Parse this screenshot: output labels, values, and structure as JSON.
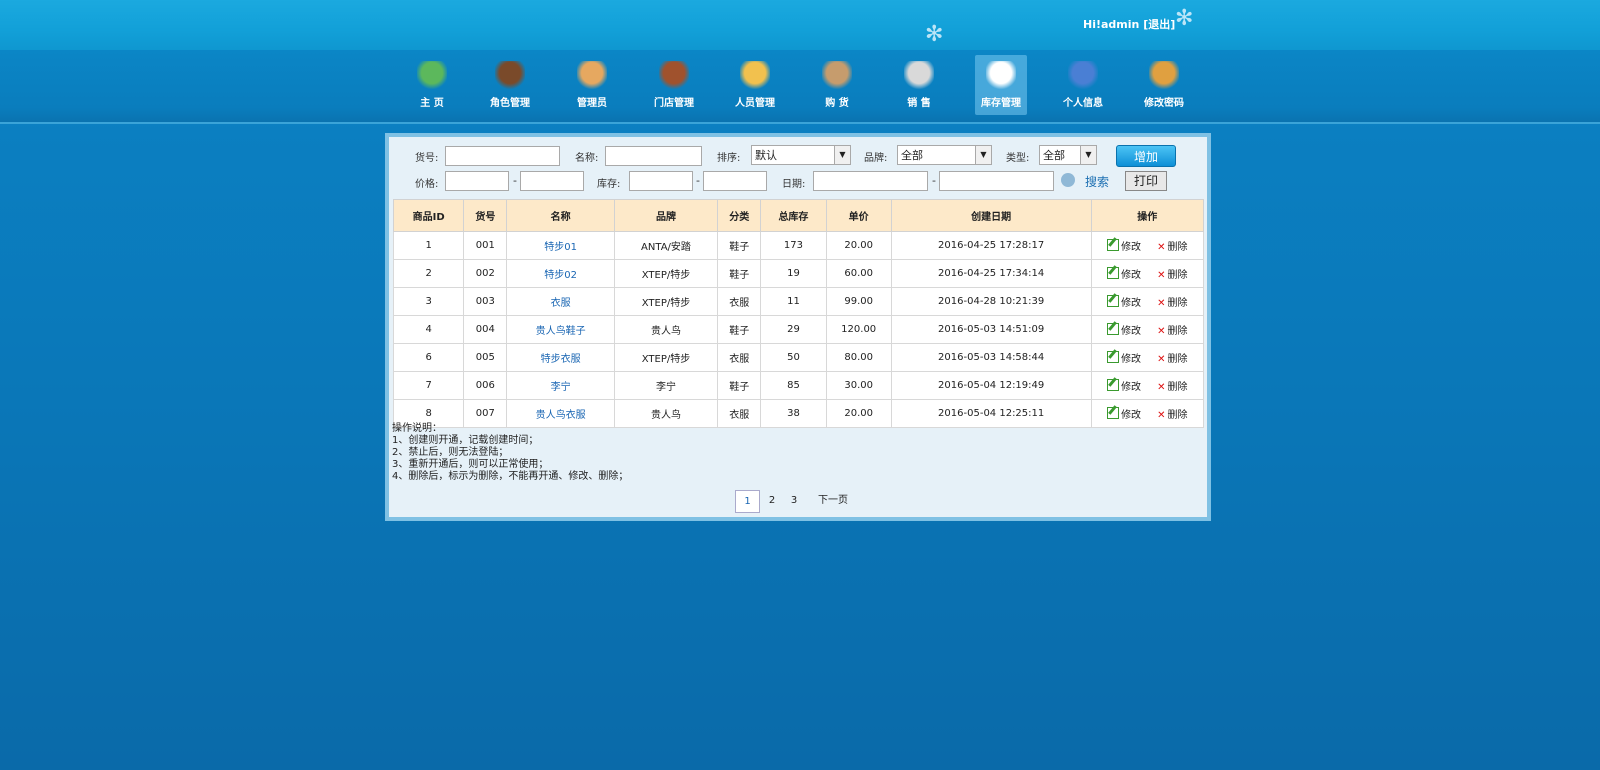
{
  "header": {
    "greeting": "Hi!admin",
    "logout": "[退出]"
  },
  "nav": [
    {
      "label": "主  页",
      "icon": "home-icon",
      "color": "#5cb85c"
    },
    {
      "label": "角色管理",
      "icon": "waiter-icon",
      "color": "#7a4a2a"
    },
    {
      "label": "管理员",
      "icon": "admin-user-icon",
      "color": "#e6a860"
    },
    {
      "label": "门店管理",
      "icon": "store-card-icon",
      "color": "#a0522d"
    },
    {
      "label": "人员管理",
      "icon": "staff-certificate-icon",
      "color": "#f2c14e"
    },
    {
      "label": "购  货",
      "icon": "purchase-clipboard-icon",
      "color": "#c69c6d"
    },
    {
      "label": "销  售",
      "icon": "sales-books-icon",
      "color": "#d9d9d9"
    },
    {
      "label": "库存管理",
      "icon": "inventory-document-icon",
      "color": "#ffffff"
    },
    {
      "label": "个人信息",
      "icon": "personal-info-users-icon",
      "color": "#4a7fd4"
    },
    {
      "label": "修改密码",
      "icon": "change-password-lock-icon",
      "color": "#e0a040"
    }
  ],
  "filters": {
    "sku_label": "货号:",
    "name_label": "名称:",
    "sort_label": "排序:",
    "sort_value": "默认",
    "brand_label": "品牌:",
    "brand_value": "全部",
    "type_label": "类型:",
    "type_value": "全部",
    "price_label": "价格:",
    "stock_label": "库存:",
    "date_label": "日期:",
    "dash": "-",
    "add_button": "增加",
    "search_button": "搜索",
    "print_button": "打印"
  },
  "table": {
    "headers": [
      "商品ID",
      "货号",
      "名称",
      "品牌",
      "分类",
      "总库存",
      "单价",
      "创建日期",
      "操作"
    ],
    "rows": [
      {
        "id": "1",
        "sku": "001",
        "name": "特步01",
        "brand": "ANTA/安踏",
        "category": "鞋子",
        "stock": "173",
        "price": "20.00",
        "created": "2016-04-25 17:28:17"
      },
      {
        "id": "2",
        "sku": "002",
        "name": "特步02",
        "brand": "XTEP/特步",
        "category": "鞋子",
        "stock": "19",
        "price": "60.00",
        "created": "2016-04-25 17:34:14"
      },
      {
        "id": "3",
        "sku": "003",
        "name": "衣服",
        "brand": "XTEP/特步",
        "category": "衣服",
        "stock": "11",
        "price": "99.00",
        "created": "2016-04-28 10:21:39"
      },
      {
        "id": "4",
        "sku": "004",
        "name": "贵人鸟鞋子",
        "brand": "贵人鸟",
        "category": "鞋子",
        "stock": "29",
        "price": "120.00",
        "created": "2016-05-03 14:51:09"
      },
      {
        "id": "6",
        "sku": "005",
        "name": "特步衣服",
        "brand": "XTEP/特步",
        "category": "衣服",
        "stock": "50",
        "price": "80.00",
        "created": "2016-05-03 14:58:44"
      },
      {
        "id": "7",
        "sku": "006",
        "name": "李宁",
        "brand": "李宁",
        "category": "鞋子",
        "stock": "85",
        "price": "30.00",
        "created": "2016-05-04 12:19:49"
      },
      {
        "id": "8",
        "sku": "007",
        "name": "贵人鸟衣服",
        "brand": "贵人鸟",
        "category": "衣服",
        "stock": "38",
        "price": "20.00",
        "created": "2016-05-04 12:25:11"
      }
    ],
    "edit_label": "修改",
    "delete_label": "删除"
  },
  "notes": [
    "操作说明：",
    "1、创建则开通，记载创建时间；",
    "2、禁止后，则无法登陆；",
    "3、重新开通后，则可以正常使用；",
    "4、删除后，标示为删除，不能再开通、修改、删除；"
  ],
  "pagination": {
    "pages": [
      "1",
      "2",
      "3"
    ],
    "current": "1",
    "next": "下一页"
  }
}
